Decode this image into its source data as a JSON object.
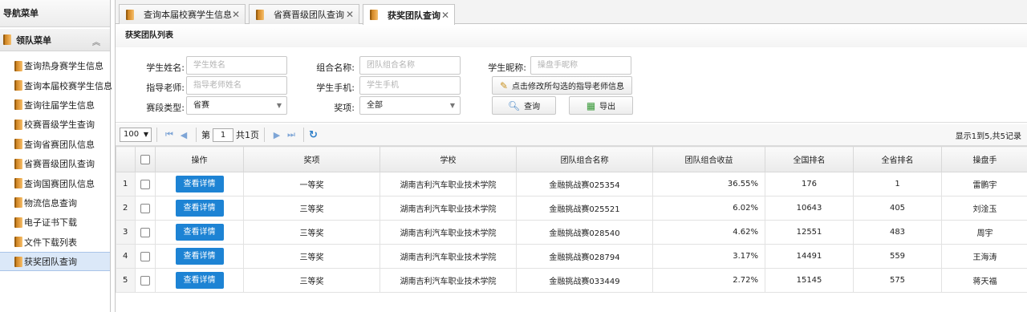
{
  "sidebar": {
    "title": "导航菜单",
    "group_label": "领队菜单",
    "items": [
      {
        "label": "查询热身赛学生信息"
      },
      {
        "label": "查询本届校赛学生信息"
      },
      {
        "label": "查询往届学生信息"
      },
      {
        "label": "校赛晋级学生查询"
      },
      {
        "label": "查询省赛团队信息"
      },
      {
        "label": "省赛晋级团队查询"
      },
      {
        "label": "查询国赛团队信息"
      },
      {
        "label": "物流信息查询"
      },
      {
        "label": "电子证书下载"
      },
      {
        "label": "文件下载列表"
      },
      {
        "label": "获奖团队查询"
      }
    ],
    "active_index": 10
  },
  "tabs": [
    {
      "label": "查询本届校赛学生信息"
    },
    {
      "label": "省赛晋级团队查询"
    },
    {
      "label": "获奖团队查询"
    }
  ],
  "panel": {
    "title": "获奖团队列表"
  },
  "form": {
    "student_name_label": "学生姓名:",
    "student_name_placeholder": "学生姓名",
    "team_name_label": "组合名称:",
    "team_name_placeholder": "团队组合名称",
    "nickname_label": "学生昵称:",
    "nickname_placeholder": "操盘手昵称",
    "teacher_label": "指导老师:",
    "teacher_placeholder": "指导老师姓名",
    "phone_label": "学生手机:",
    "phone_placeholder": "学生手机",
    "modify_teacher_button": "点击修改所勾选的指导老师信息",
    "stage_label": "赛段类型:",
    "stage_value": "省赛",
    "award_label": "奖项:",
    "award_value": "全部",
    "search_button": "查询",
    "export_button": "导出"
  },
  "pager": {
    "page_size": "100",
    "page_prefix": "第",
    "page_value": "1",
    "page_suffix": "共1页",
    "info": "显示1到5,共5记录"
  },
  "table": {
    "columns": [
      "操作",
      "奖项",
      "学校",
      "团队组合名称",
      "团队组合收益",
      "全国排名",
      "全省排名",
      "操盘手"
    ],
    "detail_label": "查看详情",
    "rows": [
      {
        "n": "1",
        "award": "一等奖",
        "school": "湖南吉利汽车职业技术学院",
        "team": "金融挑战赛025354",
        "profit": "36.55%",
        "national": "176",
        "province": "1",
        "trader": "雷鹏宇"
      },
      {
        "n": "2",
        "award": "三等奖",
        "school": "湖南吉利汽车职业技术学院",
        "team": "金融挑战赛025521",
        "profit": "6.02%",
        "national": "10643",
        "province": "405",
        "trader": "刘淦玉"
      },
      {
        "n": "3",
        "award": "三等奖",
        "school": "湖南吉利汽车职业技术学院",
        "team": "金融挑战赛028540",
        "profit": "4.62%",
        "national": "12551",
        "province": "483",
        "trader": "周宇"
      },
      {
        "n": "4",
        "award": "三等奖",
        "school": "湖南吉利汽车职业技术学院",
        "team": "金融挑战赛028794",
        "profit": "3.17%",
        "national": "14491",
        "province": "559",
        "trader": "王海涛"
      },
      {
        "n": "5",
        "award": "三等奖",
        "school": "湖南吉利汽车职业技术学院",
        "team": "金融挑战赛033449",
        "profit": "2.72%",
        "national": "15145",
        "province": "575",
        "trader": "蒋天福"
      }
    ]
  },
  "colors": {
    "accent": "#1d83d4",
    "active_nav": "#dbe8f8"
  }
}
